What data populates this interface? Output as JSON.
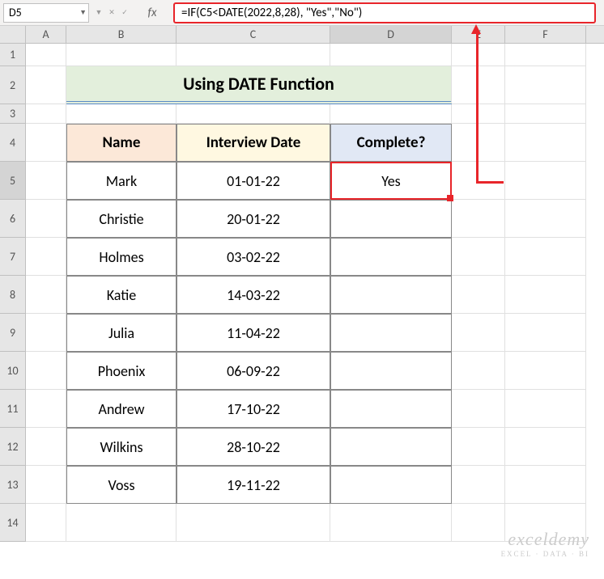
{
  "nameBox": "D5",
  "fxLabel": "fx",
  "formula": "=IF(C5<DATE(2022,8,28), \"Yes\",\"No\")",
  "columns": [
    "A",
    "B",
    "C",
    "D",
    "E",
    "F"
  ],
  "rowNums": [
    "1",
    "2",
    "3",
    "4",
    "5",
    "6",
    "7",
    "8",
    "9",
    "10",
    "11",
    "12",
    "13",
    "14"
  ],
  "title": "Using DATE Function",
  "headers": {
    "name": "Name",
    "date": "Interview Date",
    "complete": "Complete?"
  },
  "rows": [
    {
      "name": "Mark",
      "date": "01-01-22",
      "complete": "Yes"
    },
    {
      "name": "Christie",
      "date": "20-01-22",
      "complete": ""
    },
    {
      "name": "Holmes",
      "date": "03-02-22",
      "complete": ""
    },
    {
      "name": "Katie",
      "date": "14-03-22",
      "complete": ""
    },
    {
      "name": "Julia",
      "date": "11-04-22",
      "complete": ""
    },
    {
      "name": "Phoenix",
      "date": "06-09-22",
      "complete": ""
    },
    {
      "name": "Andrew",
      "date": "17-10-22",
      "complete": ""
    },
    {
      "name": "Wilkins",
      "date": "28-10-22",
      "complete": ""
    },
    {
      "name": "Voss",
      "date": "19-11-22",
      "complete": ""
    }
  ],
  "watermark": {
    "brand": "exceldemy",
    "tag": "EXCEL · DATA · BI"
  }
}
